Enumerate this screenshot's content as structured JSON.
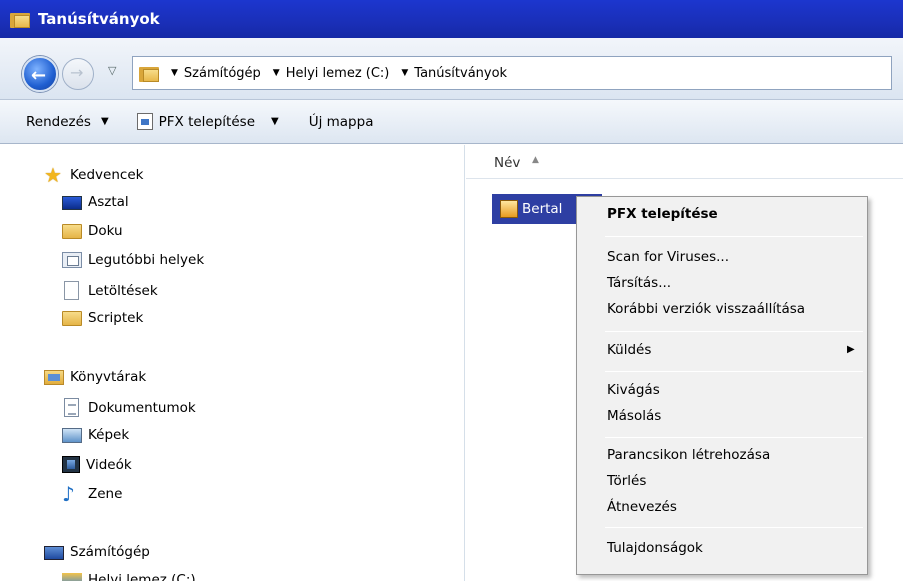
{
  "window": {
    "title": "Tanúsítványok"
  },
  "address": {
    "crumbs": [
      "Számítógép",
      "Helyi lemez (C:)",
      "Tanúsítványok"
    ]
  },
  "toolbar": {
    "organize": "Rendezés",
    "install_pfx": "PFX telepítése",
    "new_folder": "Új mappa"
  },
  "nav": {
    "favorites": {
      "label": "Kedvencek",
      "items": [
        "Asztal",
        "Doku",
        "Legutóbbi helyek",
        "Letöltések",
        "Scriptek"
      ]
    },
    "libraries": {
      "label": "Könyvtárak",
      "items": [
        "Dokumentumok",
        "Képek",
        "Videók",
        "Zene"
      ]
    },
    "computer": {
      "label": "Számítógép",
      "items": [
        "Helyi lemez (C:)"
      ]
    }
  },
  "files": {
    "column_name": "Név",
    "selected_item": "Bertal"
  },
  "context_menu": {
    "items": [
      "PFX telepítése",
      "Scan for Viruses...",
      "Társítás...",
      "Korábbi verziók visszaállítása",
      "Küldés",
      "Kivágás",
      "Másolás",
      "Parancsikon létrehozása",
      "Törlés",
      "Átnevezés",
      "Tulajdonságok"
    ]
  }
}
